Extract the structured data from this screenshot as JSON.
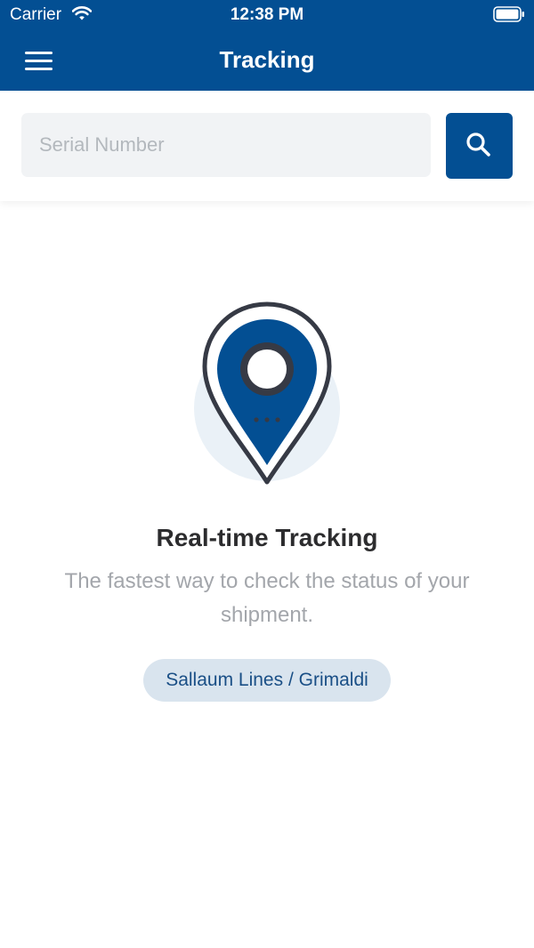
{
  "status_bar": {
    "carrier": "Carrier",
    "time": "12:38 PM"
  },
  "nav": {
    "title": "Tracking",
    "menu_icon": "hamburger-menu-icon"
  },
  "search": {
    "placeholder": "Serial Number",
    "value": "",
    "button_icon": "search-icon"
  },
  "empty_state": {
    "icon": "location-pin-icon",
    "headline": "Real-time Tracking",
    "subtitle": "The fastest way to check the status of your shipment.",
    "carrier_chip": "Sallaum Lines / Grimaldi"
  },
  "colors": {
    "primary": "#034f93",
    "chip_background": "#d9e4ee",
    "chip_text": "#1a4f86",
    "input_background": "#f1f3f5",
    "headline": "#2c2c2e",
    "subtitle": "#a3a6ab"
  }
}
